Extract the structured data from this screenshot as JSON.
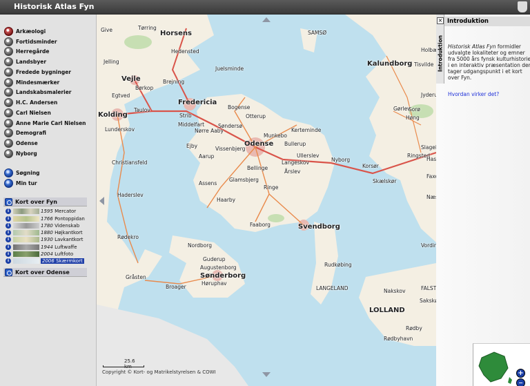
{
  "app": {
    "title": "Historisk Atlas Fyn"
  },
  "layers": [
    {
      "label": "Arkæologi",
      "icon": "archaeology-icon"
    },
    {
      "label": "Fortidsminder",
      "icon": "monument-icon"
    },
    {
      "label": "Herregårde",
      "icon": "manor-icon"
    },
    {
      "label": "Landsbyer",
      "icon": "village-icon"
    },
    {
      "label": "Fredede bygninger",
      "icon": "protected-building-icon"
    },
    {
      "label": "Mindesmærker",
      "icon": "memorial-icon"
    },
    {
      "label": "Landskabsmalerier",
      "icon": "painting-icon"
    },
    {
      "label": "H.C. Andersen",
      "icon": "portrait-icon"
    },
    {
      "label": "Carl Nielsen",
      "icon": "portrait-icon"
    },
    {
      "label": "Anne Marie Carl Nielsen",
      "icon": "portrait-icon"
    },
    {
      "label": "Demografi",
      "icon": "demography-icon"
    },
    {
      "label": "Odense",
      "icon": "city-icon"
    },
    {
      "label": "Nyborg",
      "icon": "city-icon"
    }
  ],
  "tools": [
    {
      "label": "Søgning",
      "icon": "search-icon"
    },
    {
      "label": "Min tur",
      "icon": "route-icon"
    }
  ],
  "kort_fyn": {
    "heading": "Kort over Fyn",
    "maps": [
      {
        "year": "1595",
        "name": "Mercator"
      },
      {
        "year": "1766",
        "name": "Pontoppidan"
      },
      {
        "year": "1780",
        "name": "Videnskab"
      },
      {
        "year": "1880",
        "name": "Højkantkort"
      },
      {
        "year": "1930",
        "name": "Lavkantkort"
      },
      {
        "year": "1944",
        "name": "Luftwaffe"
      },
      {
        "year": "2004",
        "name": "Luftfoto"
      },
      {
        "year": "2006",
        "name": "Skærmkort",
        "selected": true
      }
    ]
  },
  "kort_odense": {
    "heading": "Kort over Odense"
  },
  "map": {
    "scale_label": "25.6 km",
    "copyright": "Copyright © Kort- og Matrikelstyrelsen & COWI",
    "places_large": [
      "Odense",
      "Svendborg",
      "Fredericia",
      "Kolding",
      "Vejle",
      "Horsens",
      "Sønderborg",
      "Kalundborg",
      "LOLLAND"
    ],
    "places": [
      "Give",
      "Tørring",
      "Hedensted",
      "Juelsminde",
      "Jelling",
      "Børkop",
      "Brejning",
      "Egtved",
      "Taulov",
      "Strib",
      "Middelfart",
      "Nørre Aaby",
      "Bogense",
      "Otterup",
      "Søndersø",
      "Munkebo",
      "Kerteminde",
      "Bullerup",
      "Ullerslev",
      "Langeskov",
      "Årslev",
      "Nyborg",
      "Korsør",
      "Skælskør",
      "Vissenbjerg",
      "Aarup",
      "Ejby",
      "Bellinge",
      "Glamsbjerg",
      "Assens",
      "Haarby",
      "Ringe",
      "Faaborg",
      "Lunderskov",
      "Christiansfeld",
      "Haderslev",
      "Rødekro",
      "Nordborg",
      "Guderup",
      "Augustenborg",
      "Høruphav",
      "Broager",
      "Gråsten",
      "Rudkøbing",
      "LANGELAND",
      "Nakskov",
      "Sakskøbing",
      "Rødby",
      "Rødbyhavn",
      "Ringsted",
      "Haslev",
      "Næstved",
      "Vordingborg",
      "FALSTER",
      "Slagelse",
      "Sorø",
      "Gørlev",
      "Høng",
      "SAMSØ",
      "Tisvilde",
      "Holbæk",
      "Jyderup",
      "Faxe"
    ]
  },
  "panel": {
    "tab_label": "Introduktion",
    "close": "×",
    "heading": "Introduktion",
    "body_italic": "Historisk Atlas Fyn",
    "body": " formidler udvalgte lokaliteter og emner fra 5000 års fynsk kulturhistorie i en interaktiv præsentation der tager udgangspunkt i et kort over Fyn.",
    "link": "Hvordan virker det?"
  },
  "overview": {
    "zoom_in": "+",
    "zoom_out": "−"
  },
  "colors": {
    "sea": "#bfe0ee",
    "land": "#f4efe3",
    "road": "#e98a4c",
    "road_main": "#d9544a",
    "urban": "#e9b9b1",
    "forest": "#c7dfb3",
    "selected": "#1f3fa8",
    "link": "#1d2fd9"
  }
}
